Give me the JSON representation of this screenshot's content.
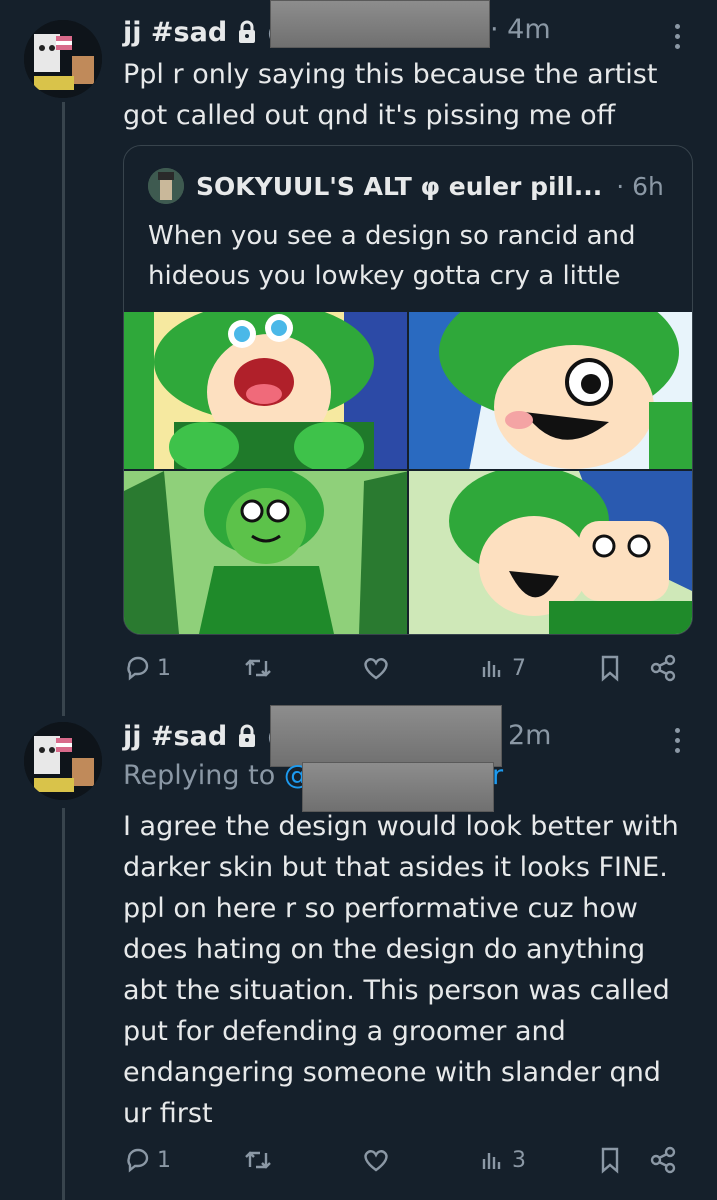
{
  "tweet1": {
    "display_name": "jj #sad",
    "handle": "@",
    "time": "· 4m",
    "text_lines": [
      "Ppl r only saying this because the artist",
      "got called out qnd it's pissing me off"
    ],
    "quote": {
      "display_name": "SOKYUUL'S ALT φ euler pill...",
      "time": "· 6h",
      "text_lines": [
        "When you see a design so rancid and",
        "hideous you lowkey gotta cry a little"
      ]
    },
    "actions": {
      "replies": "1",
      "retweets": "",
      "likes": "",
      "views": "7"
    }
  },
  "tweet2": {
    "display_name": "jj #sad",
    "handle": "@",
    "time": "2m",
    "replying_to": "Replying to",
    "replying_handle": "@",
    "replying_handle_tail": "r",
    "text_lines": [
      "I agree the design would look better with",
      "darker skin but that asides it looks FINE.",
      "ppl on here r so performative cuz how",
      "does hating on the design do anything",
      "abt the situation. This person was called",
      "put for defending a groomer and",
      "endangering someone with slander qnd",
      "ur first"
    ],
    "actions": {
      "replies": "1",
      "retweets": "",
      "likes": "",
      "views": "3"
    }
  },
  "colors": {
    "background": "#15202b",
    "secondary_text": "#8b98a5",
    "link": "#1d9bf0",
    "border": "#38444d"
  },
  "icons": [
    "lock-icon",
    "more-icon",
    "reply-icon",
    "retweet-icon",
    "like-icon",
    "views-icon",
    "bookmark-icon",
    "share-icon"
  ],
  "images": [
    "green-haired-character-excited",
    "green-haired-character-winking",
    "green-haired-character-tank-top",
    "green-haired-character-with-blue-haired-friend"
  ]
}
